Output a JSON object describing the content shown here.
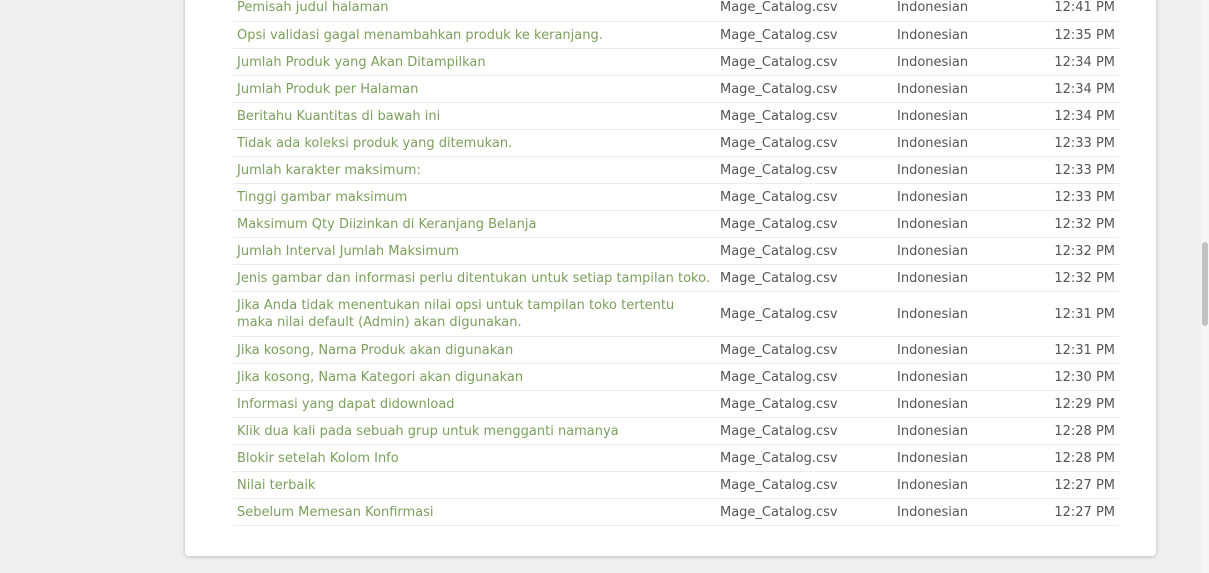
{
  "table": {
    "rows": [
      {
        "text": "Pemisah judul halaman",
        "file": "Mage_Catalog.csv",
        "language": "Indonesian",
        "time": "12:41 PM"
      },
      {
        "text": "Opsi validasi gagal menambahkan produk ke keranjang.",
        "file": "Mage_Catalog.csv",
        "language": "Indonesian",
        "time": "12:35 PM"
      },
      {
        "text": "Jumlah Produk yang Akan Ditampilkan",
        "file": "Mage_Catalog.csv",
        "language": "Indonesian",
        "time": "12:34 PM"
      },
      {
        "text": "Jumlah Produk per Halaman",
        "file": "Mage_Catalog.csv",
        "language": "Indonesian",
        "time": "12:34 PM"
      },
      {
        "text": "Beritahu Kuantitas di bawah ini",
        "file": "Mage_Catalog.csv",
        "language": "Indonesian",
        "time": "12:34 PM"
      },
      {
        "text": "Tidak ada koleksi produk yang ditemukan.",
        "file": "Mage_Catalog.csv",
        "language": "Indonesian",
        "time": "12:33 PM"
      },
      {
        "text": "Jumlah karakter maksimum:",
        "file": "Mage_Catalog.csv",
        "language": "Indonesian",
        "time": "12:33 PM"
      },
      {
        "text": "Tinggi gambar maksimum",
        "file": "Mage_Catalog.csv",
        "language": "Indonesian",
        "time": "12:33 PM"
      },
      {
        "text": "Maksimum Qty Diizinkan di Keranjang Belanja",
        "file": "Mage_Catalog.csv",
        "language": "Indonesian",
        "time": "12:32 PM"
      },
      {
        "text": "Jumlah Interval Jumlah Maksimum",
        "file": "Mage_Catalog.csv",
        "language": "Indonesian",
        "time": "12:32 PM"
      },
      {
        "text": "Jenis gambar dan informasi perlu ditentukan untuk setiap tampilan toko.",
        "file": "Mage_Catalog.csv",
        "language": "Indonesian",
        "time": "12:32 PM"
      },
      {
        "text": "Jika Anda tidak menentukan nilai opsi untuk tampilan toko tertentu maka nilai default (Admin) akan digunakan.",
        "file": "Mage_Catalog.csv",
        "language": "Indonesian",
        "time": "12:31 PM"
      },
      {
        "text": "Jika kosong, Nama Produk akan digunakan",
        "file": "Mage_Catalog.csv",
        "language": "Indonesian",
        "time": "12:31 PM"
      },
      {
        "text": "Jika kosong, Nama Kategori akan digunakan",
        "file": "Mage_Catalog.csv",
        "language": "Indonesian",
        "time": "12:30 PM"
      },
      {
        "text": "Informasi yang dapat didownload",
        "file": "Mage_Catalog.csv",
        "language": "Indonesian",
        "time": "12:29 PM"
      },
      {
        "text": "Klik dua kali pada sebuah grup untuk mengganti namanya",
        "file": "Mage_Catalog.csv",
        "language": "Indonesian",
        "time": "12:28 PM"
      },
      {
        "text": "Blokir setelah Kolom Info",
        "file": "Mage_Catalog.csv",
        "language": "Indonesian",
        "time": "12:28 PM"
      },
      {
        "text": "Nilai terbaik",
        "file": "Mage_Catalog.csv",
        "language": "Indonesian",
        "time": "12:27 PM"
      },
      {
        "text": "Sebelum Memesan Konfirmasi",
        "file": "Mage_Catalog.csv",
        "language": "Indonesian",
        "time": "12:27 PM"
      }
    ]
  },
  "colors": {
    "link": "#7ba05b",
    "text": "#555555",
    "background": "#f0f0f0",
    "card": "#ffffff"
  }
}
